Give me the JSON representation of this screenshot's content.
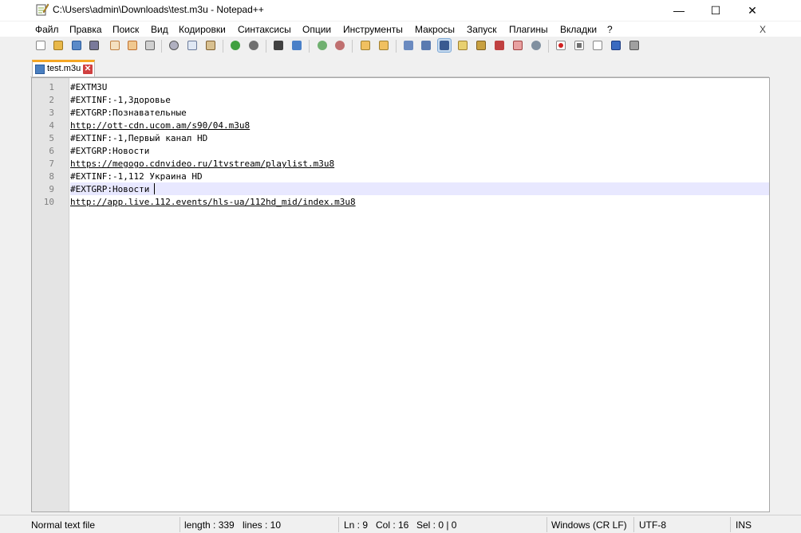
{
  "window": {
    "title": "C:\\Users\\admin\\Downloads\\test.m3u - Notepad++",
    "minimize": "—",
    "maximize": "☐",
    "close": "✕"
  },
  "menu": {
    "items": [
      "Файл",
      "Правка",
      "Поиск",
      "Вид",
      "Кодировки",
      "Синтаксисы",
      "Опции",
      "Инструменты",
      "Макросы",
      "Запуск",
      "Плагины",
      "Вкладки",
      "?"
    ],
    "close_doc": "X"
  },
  "tabs": [
    {
      "label": "test.m3u",
      "close": "✕"
    }
  ],
  "editor": {
    "current_line": 9,
    "lines": [
      {
        "n": "1",
        "text": "#EXTM3U",
        "link": false
      },
      {
        "n": "2",
        "text": "#EXTINF:-1,Здоровье",
        "link": false
      },
      {
        "n": "3",
        "text": "#EXTGRP:Познавательные",
        "link": false
      },
      {
        "n": "4",
        "text": "http://ott-cdn.ucom.am/s90/04.m3u8",
        "link": true
      },
      {
        "n": "5",
        "text": "#EXTINF:-1,Первый канал HD",
        "link": false
      },
      {
        "n": "6",
        "text": "#EXTGRP:Новости",
        "link": false
      },
      {
        "n": "7",
        "text": "https://megogo.cdnvideo.ru/1tvstream/playlist.m3u8",
        "link": true
      },
      {
        "n": "8",
        "text": "#EXTINF:-1,112 Украина HD",
        "link": false
      },
      {
        "n": "9",
        "text": "#EXTGRP:Новости",
        "link": false
      },
      {
        "n": "10",
        "text": "http://app.live.112.events/hls-ua/112hd_mid/index.m3u8",
        "link": true
      }
    ]
  },
  "status": {
    "file_type": "Normal text file",
    "length": "length : 339",
    "lines": "lines : 10",
    "ln": "Ln : 9",
    "col": "Col : 16",
    "sel": "Sel : 0 | 0",
    "eol": "Windows (CR LF)",
    "encoding": "UTF-8",
    "mode": "INS"
  },
  "toolbar_icons": [
    "new-file-icon",
    "open-file-icon",
    "save-icon",
    "save-all-icon",
    "close-icon",
    "close-all-icon",
    "print-icon",
    "cut-icon",
    "copy-icon",
    "paste-icon",
    "undo-icon",
    "redo-icon",
    "find-icon",
    "replace-icon",
    "zoom-in-icon",
    "zoom-out-icon",
    "sync-vertical-icon",
    "sync-horizontal-icon",
    "word-wrap-icon",
    "show-all-chars-icon",
    "indent-guide-icon",
    "user-lang-icon",
    "doc-map-icon",
    "function-list-icon",
    "folder-workspace-icon",
    "monitoring-icon",
    "record-macro-icon",
    "stop-record-icon",
    "play-macro-icon",
    "run-macro-multiple-icon",
    "save-macro-icon"
  ]
}
